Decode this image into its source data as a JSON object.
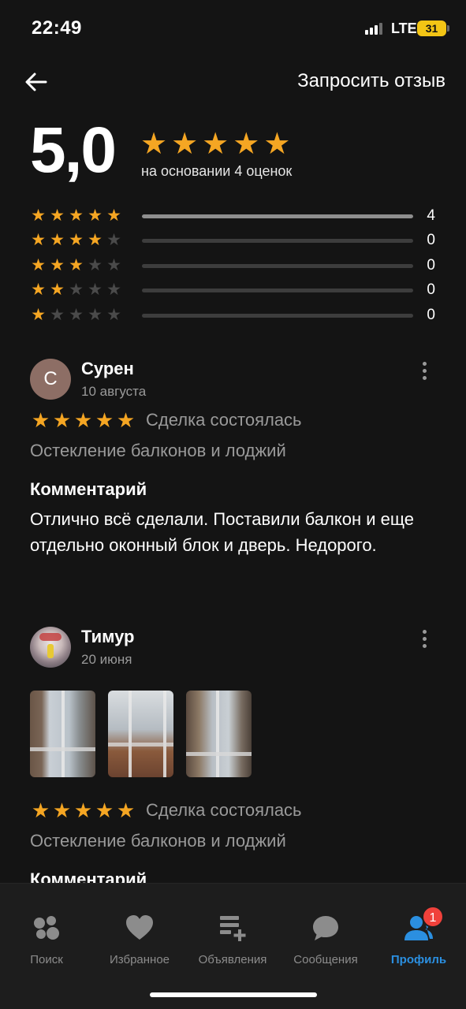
{
  "status_bar": {
    "time": "22:49",
    "network": "LTE",
    "battery": "31"
  },
  "header": {
    "request_review_label": "Запросить отзыв"
  },
  "summary": {
    "score": "5,0",
    "based_on": "на основании 4 оценок",
    "distribution": [
      {
        "stars": 5,
        "count": "4",
        "fraction": 1.0
      },
      {
        "stars": 4,
        "count": "0",
        "fraction": 0
      },
      {
        "stars": 3,
        "count": "0",
        "fraction": 0
      },
      {
        "stars": 2,
        "count": "0",
        "fraction": 0
      },
      {
        "stars": 1,
        "count": "0",
        "fraction": 0
      }
    ]
  },
  "reviews": [
    {
      "avatar_letter": "С",
      "author": "Сурен",
      "date": "10 августа",
      "rating": 5,
      "deal_status": "Сделка состоялась",
      "category": "Остекление балконов и лоджий",
      "comment_heading": "Комментарий",
      "comment": "Отлично всё сделали. Поставили балкон и еще отдельно оконный блок и дверь. Недорого."
    },
    {
      "author": "Тимур",
      "date": "20 июня",
      "rating": 5,
      "photo_count": 3,
      "deal_status": "Сделка состоялась",
      "category": "Остекление балконов и лоджий",
      "comment_heading": "Комментарий"
    }
  ],
  "bottom_nav": {
    "items": [
      {
        "label": "Поиск",
        "icon": "search-dots-icon"
      },
      {
        "label": "Избранное",
        "icon": "heart-icon"
      },
      {
        "label": "Объявления",
        "icon": "listings-add-icon"
      },
      {
        "label": "Сообщения",
        "icon": "chat-bubble-icon"
      },
      {
        "label": "Профиль",
        "icon": "profile-icon",
        "active": true,
        "badge": "1"
      }
    ]
  },
  "colors": {
    "star": "#f5a623",
    "accent": "#2b8fe0",
    "badge": "#f0413b",
    "background": "#141414"
  }
}
